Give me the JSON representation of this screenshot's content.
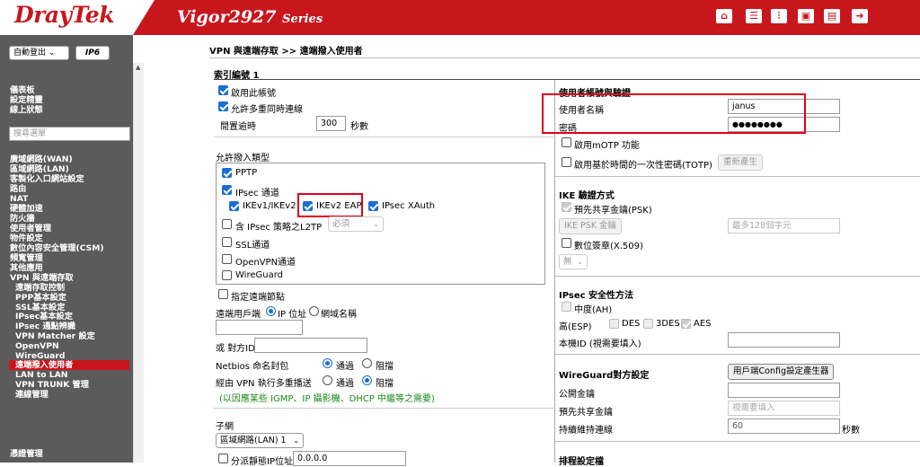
{
  "brand": {
    "logo": "DrayTek",
    "model": "Vigor2927",
    "series": "Series"
  },
  "header_icons": [
    "home-icon",
    "list-icon",
    "settings-sliders-icon",
    "save-icon",
    "book-icon",
    "logout-icon"
  ],
  "sidebar": {
    "logout_select": "自動登出",
    "ip6_label": "IP6",
    "search_placeholder": "搜尋選單",
    "items": [
      "儀表板",
      "設定精靈",
      "線上狀態",
      "廣域網路(WAN)",
      "區域網路(LAN)",
      "客製化入口網站設定",
      "路由",
      "NAT",
      "硬體加速",
      "防火牆",
      "使用者管理",
      "物件設定",
      "數位內容安全管理(CSM)",
      "頻寬管理",
      "其他應用",
      "VPN 與遠端存取"
    ],
    "sub_items": [
      "遠端存取控制",
      "PPP基本設定",
      "SSL基本設定",
      "IPsec基本設定",
      "IPsec 通點辨識",
      "VPN Matcher 設定",
      "OpenVPN",
      "WireGuard",
      "遠端撥入使用者",
      "LAN to LAN",
      "VPN TRUNK 管理",
      "連線管理"
    ],
    "last_item": "憑證管理"
  },
  "page": {
    "breadcrumb": "VPN 與遠端存取 >> 遠端撥入使用者",
    "index_label": "索引編號 1",
    "enable_account": "啟用此帳號",
    "allow_multi": "允許多重同時連線",
    "idle_timeout_label": "閒置逾時",
    "idle_timeout_value": "300",
    "idle_timeout_unit": "秒數",
    "allowed_dialin_type": "允許撥入類型",
    "pptp": "PPTP",
    "ipsec_tunnel": "IPsec 通道",
    "ikev1_ikev2": "IKEv1/IKEv2",
    "ikev2_eap": "IKEv2 EAP",
    "ipsec_xauth": "IPsec XAuth",
    "l2tp_label": "含 IPsec 策略之L2TP",
    "l2tp_select": "必須",
    "ssl_tunnel": "SSL通道",
    "openvpn_tunnel": "OpenVPN通道",
    "wireguard": "WireGuard",
    "specify_remote": "指定遠端節點",
    "remote_client_label": "遠端用戶端",
    "ip_address_opt": "IP 位址",
    "domain_name_opt": "網域名稱",
    "or_peer_id": "或 對方ID",
    "netbios_label": "Netbios 命名封包",
    "pass_opt": "通過",
    "block_opt": "阻擋",
    "multicast_label": "經由 VPN 執行多重播送",
    "multicast_note": "(以因應某些 IGMP、IP 攝影機、DHCP 中繼等之需要)",
    "subnet_label": "子網",
    "subnet_select": "區域網路(LAN) 1",
    "assign_ip_label": "分派靜態IP位址",
    "assign_ip_value": "0.0.0.0",
    "auth_title": "使用者帳號與驗證",
    "username_label": "使用者名稱",
    "username_value": "janus",
    "password_label": "密碼",
    "password_value": "●●●●●●●●",
    "motp": "啟用mOTP 功能",
    "totp": "啟用基於時間的一次性密碼(TOTP)",
    "regen_button": "重新產生",
    "ike_title": "IKE 驗證方式",
    "psk": "預先共享金鑰(PSK)",
    "ike_psk_button": "IKE PSK 金鑰",
    "ike_psk_placeholder": "最多128個字元",
    "cert": "數位簽章(X.509)",
    "cert_select": "無",
    "ipsec_sec_title": "IPsec 安全性方法",
    "medium_ah": "中度(AH)",
    "high_esp": "高(ESP)",
    "des": "DES",
    "3des": "3DES",
    "aes": "AES",
    "local_id": "本機ID (視需要填入)",
    "wg_title": "WireGuard對方設定",
    "wg_config_button": "用戶端Config設定產生器",
    "public_key": "公開金鑰",
    "preshared_key": "預先共享金鑰",
    "preshared_placeholder": "視需要填入",
    "keepalive": "持續維持連線",
    "keepalive_value": "60",
    "keepalive_unit": "秒數",
    "schedule_title": "排程設定檔"
  }
}
